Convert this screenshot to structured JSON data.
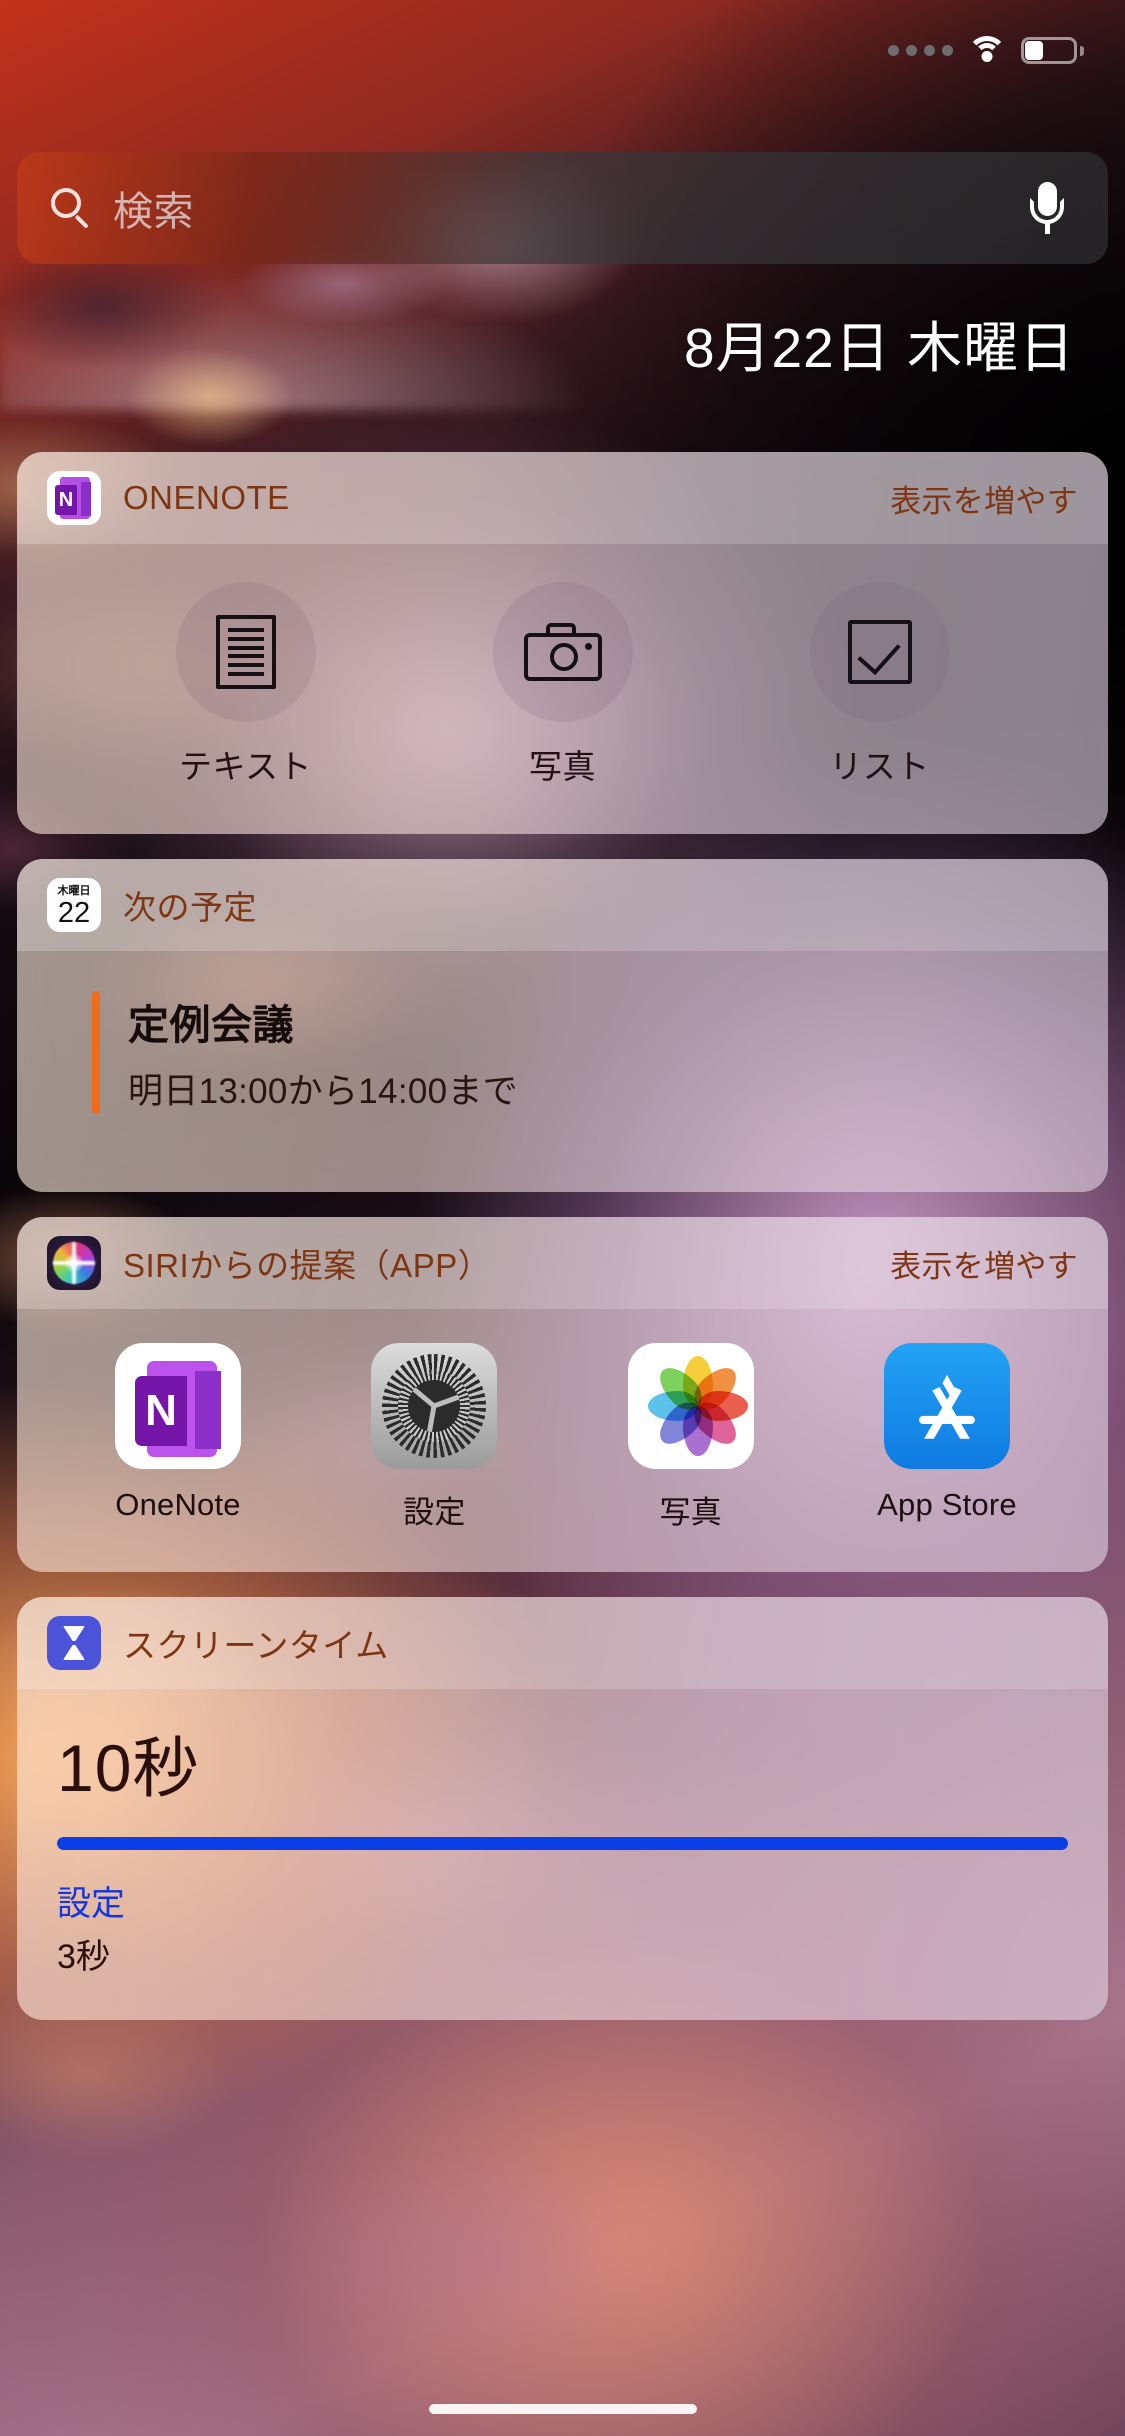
{
  "status_bar": {
    "signal_icon": "signal-dots-icon",
    "wifi_icon": "wifi-icon",
    "battery_icon": "battery-icon"
  },
  "search": {
    "placeholder": "検索",
    "search_icon": "search-icon",
    "mic_icon": "microphone-icon"
  },
  "date_header": "8月22日 木曜日",
  "widgets": {
    "onenote": {
      "title": "ONENOTE",
      "more_label": "表示を増やす",
      "app_icon": "onenote-icon",
      "actions": [
        {
          "label": "テキスト",
          "icon": "document-icon"
        },
        {
          "label": "写真",
          "icon": "camera-icon"
        },
        {
          "label": "リスト",
          "icon": "checkbox-icon"
        }
      ]
    },
    "calendar": {
      "title": "次の予定",
      "icon_weekday": "木曜日",
      "icon_day": "22",
      "event": {
        "title": "定例会議",
        "time": "明日13:00から14:00まで",
        "accent_color": "#ef6c1d"
      }
    },
    "siri": {
      "title": "SIRIからの提案（APP）",
      "more_label": "表示を増やす",
      "app_icon": "siri-icon",
      "apps": [
        {
          "label": "OneNote",
          "icon": "onenote-icon"
        },
        {
          "label": "設定",
          "icon": "settings-gear-icon"
        },
        {
          "label": "写真",
          "icon": "photos-icon"
        },
        {
          "label": "App Store",
          "icon": "app-store-icon"
        }
      ]
    },
    "screen_time": {
      "title": "スクリーンタイム",
      "app_icon": "hourglass-icon",
      "total": "10秒",
      "bar_fill_percent": 100,
      "bar_color": "#0a3fe8",
      "app_name": "設定",
      "app_time": "3秒"
    }
  },
  "home_indicator": "home-indicator"
}
